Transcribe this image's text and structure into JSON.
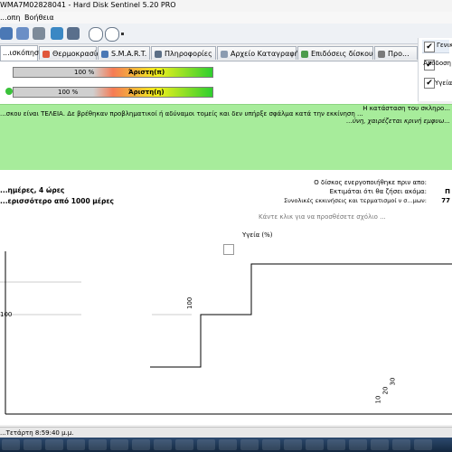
{
  "window": {
    "title": "WMA7M02828041 - Hard Disk Sentinel 5.20 PRO"
  },
  "menu": {
    "items": [
      "...οπη",
      "Βοήθεια"
    ]
  },
  "tabs": [
    {
      "label": "...ισκόπηση",
      "active": true
    },
    {
      "label": "Θερμοκρασία"
    },
    {
      "label": "S.M.A.R.T."
    },
    {
      "label": "Πληροφορίες"
    },
    {
      "label": "Αρχείο Καταγραφής"
    },
    {
      "label": "Επιδόσεις δίσκου"
    },
    {
      "label": "Προ..."
    }
  ],
  "right_panel": {
    "items": [
      {
        "label": "Γενικ...",
        "checked": true
      },
      {
        "label": "Απόδοση",
        "checked": true
      },
      {
        "label": "Υγεία",
        "checked": true
      }
    ]
  },
  "metrics": {
    "performance": {
      "percent_label": "100 %",
      "rating": "Άριστη(π)",
      "value_pct": 100
    },
    "health": {
      "percent_label": "100 %",
      "rating": "Άριστη(η)",
      "value_pct": 100
    },
    "colors": {
      "green": "#2fcf2f",
      "yellow": "#f2f01c",
      "red": "#f57b55"
    }
  },
  "status_area": {
    "heading": "Η κατάσταση του σκληρο...",
    "description": "...σκου είναι ΤΕΛΕΙΑ. Δε βρέθηκαν προβληματικοί ή αδύναμοι τομείς και δεν υπήρξε σφάλμα κατά την εκκίνηση ...",
    "italic_note": "...ύνη, χαιρέζεται κρινή εμφυω...",
    "background": "#a7ec9b"
  },
  "info": {
    "left_line1": "...ημέρες, 4 ώρες",
    "left_line2": "...ερισσότερο από 1000 μέρες",
    "right_line1": "Ο δίσκος ενεργοποιήθηκε πριν απο:",
    "right_line2": "Εκτιμάται ότι θα ζήσει ακόμα:",
    "right_line3": "Συνολικές εκκινήσεις και τερματισμοί ν σ...μων:",
    "right_value2": "Π",
    "right_value3": "77",
    "comment_placeholder": "Κάντε κλικ για να προσθέσετε σχόλιο ..."
  },
  "chart_data": {
    "type": "line",
    "title": "Υγεία (%)",
    "ytick_labels": [
      "100",
      "100"
    ],
    "xtick_labels": [
      "10",
      "20",
      "30"
    ]
  },
  "statusbar": {
    "text": "...Τετάρτη 8:59:40 μ.μ."
  }
}
